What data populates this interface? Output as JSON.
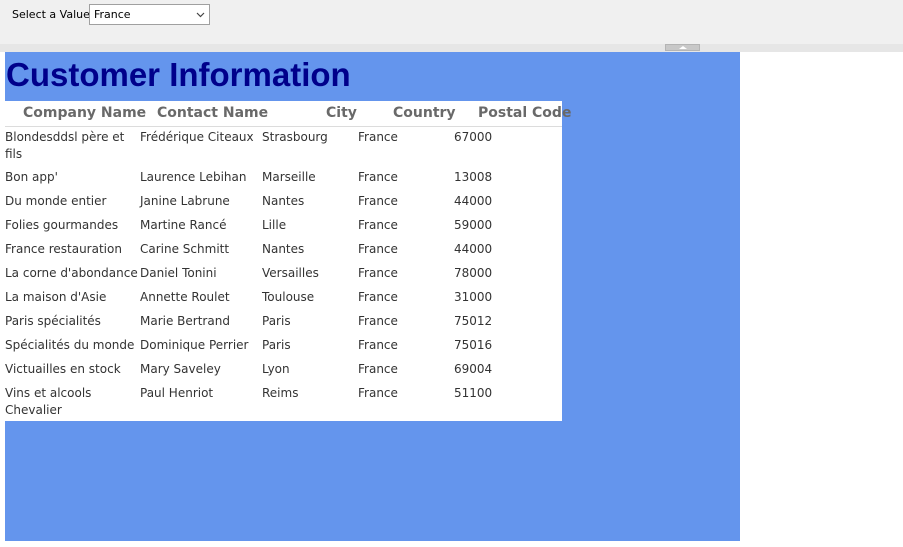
{
  "param": {
    "label": "Select a Value",
    "selected": "France"
  },
  "report": {
    "title": "Customer Information",
    "columns": [
      "Company Name",
      "Contact Name",
      "City",
      "Country",
      "Postal Code"
    ],
    "rows": [
      [
        "Blondesddsl père et fils",
        "Frédérique Citeaux",
        "Strasbourg",
        "France",
        "67000"
      ],
      [
        "Bon app'",
        "Laurence Lebihan",
        "Marseille",
        "France",
        "13008"
      ],
      [
        "Du monde entier",
        "Janine Labrune",
        "Nantes",
        "France",
        "44000"
      ],
      [
        "Folies gourmandes",
        "Martine Rancé",
        "Lille",
        "France",
        "59000"
      ],
      [
        "France restauration",
        "Carine Schmitt",
        "Nantes",
        "France",
        "44000"
      ],
      [
        "La corne d'abondance",
        "Daniel Tonini",
        "Versailles",
        "France",
        "78000"
      ],
      [
        "La maison d'Asie",
        "Annette Roulet",
        "Toulouse",
        "France",
        "31000"
      ],
      [
        "Paris spécialités",
        "Marie Bertrand",
        "Paris",
        "France",
        "75012"
      ],
      [
        "Spécialités du monde",
        "Dominique Perrier",
        "Paris",
        "France",
        "75016"
      ],
      [
        "Victuailles en stock",
        "Mary Saveley",
        "Lyon",
        "France",
        "69004"
      ],
      [
        "Vins et alcools Chevalier",
        "Paul Henriot",
        "Reims",
        "France",
        "51100"
      ]
    ]
  },
  "icons": {
    "dropdown": "chevron-down-icon",
    "splitter": "collapse-up-icon"
  },
  "colors": {
    "report_background": "#6495ed",
    "title": "#00008b",
    "header_text": "#696969"
  }
}
